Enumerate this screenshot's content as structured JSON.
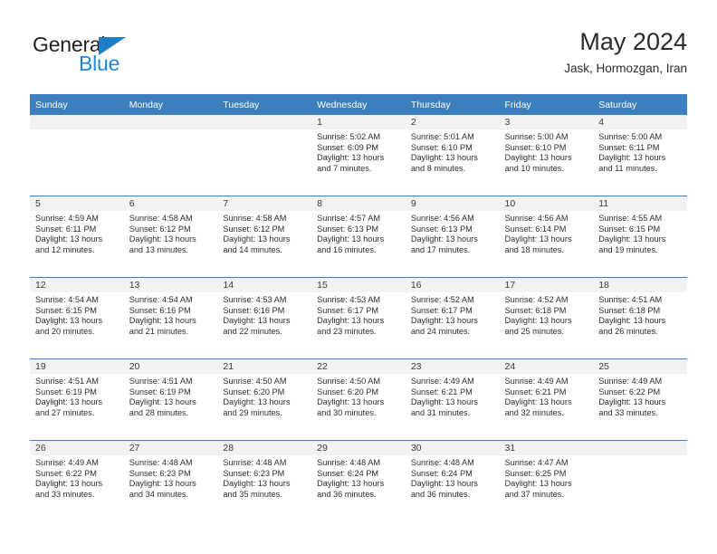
{
  "brand": {
    "name_top": "General",
    "name_bottom": "Blue",
    "color_dark": "#231f20",
    "color_blue": "#1f87d4"
  },
  "header": {
    "title": "May 2024",
    "subtitle": "Jask, Hormozgan, Iran"
  },
  "theme": {
    "header_band": "#3d7ebd",
    "day_band": "#f2f2f2",
    "text": "#2d2d2d"
  },
  "weekdays": [
    "Sunday",
    "Monday",
    "Tuesday",
    "Wednesday",
    "Thursday",
    "Friday",
    "Saturday"
  ],
  "labels": {
    "sunrise": "Sunrise:",
    "sunset": "Sunset:",
    "daylight": "Daylight:"
  },
  "weeks": [
    [
      {
        "day": "",
        "sunrise": "",
        "sunset": "",
        "daylight": ""
      },
      {
        "day": "",
        "sunrise": "",
        "sunset": "",
        "daylight": ""
      },
      {
        "day": "",
        "sunrise": "",
        "sunset": "",
        "daylight": ""
      },
      {
        "day": "1",
        "sunrise": "Sunrise: 5:02 AM",
        "sunset": "Sunset: 6:09 PM",
        "daylight": "Daylight: 13 hours and 7 minutes."
      },
      {
        "day": "2",
        "sunrise": "Sunrise: 5:01 AM",
        "sunset": "Sunset: 6:10 PM",
        "daylight": "Daylight: 13 hours and 8 minutes."
      },
      {
        "day": "3",
        "sunrise": "Sunrise: 5:00 AM",
        "sunset": "Sunset: 6:10 PM",
        "daylight": "Daylight: 13 hours and 10 minutes."
      },
      {
        "day": "4",
        "sunrise": "Sunrise: 5:00 AM",
        "sunset": "Sunset: 6:11 PM",
        "daylight": "Daylight: 13 hours and 11 minutes."
      }
    ],
    [
      {
        "day": "5",
        "sunrise": "Sunrise: 4:59 AM",
        "sunset": "Sunset: 6:11 PM",
        "daylight": "Daylight: 13 hours and 12 minutes."
      },
      {
        "day": "6",
        "sunrise": "Sunrise: 4:58 AM",
        "sunset": "Sunset: 6:12 PM",
        "daylight": "Daylight: 13 hours and 13 minutes."
      },
      {
        "day": "7",
        "sunrise": "Sunrise: 4:58 AM",
        "sunset": "Sunset: 6:12 PM",
        "daylight": "Daylight: 13 hours and 14 minutes."
      },
      {
        "day": "8",
        "sunrise": "Sunrise: 4:57 AM",
        "sunset": "Sunset: 6:13 PM",
        "daylight": "Daylight: 13 hours and 16 minutes."
      },
      {
        "day": "9",
        "sunrise": "Sunrise: 4:56 AM",
        "sunset": "Sunset: 6:13 PM",
        "daylight": "Daylight: 13 hours and 17 minutes."
      },
      {
        "day": "10",
        "sunrise": "Sunrise: 4:56 AM",
        "sunset": "Sunset: 6:14 PM",
        "daylight": "Daylight: 13 hours and 18 minutes."
      },
      {
        "day": "11",
        "sunrise": "Sunrise: 4:55 AM",
        "sunset": "Sunset: 6:15 PM",
        "daylight": "Daylight: 13 hours and 19 minutes."
      }
    ],
    [
      {
        "day": "12",
        "sunrise": "Sunrise: 4:54 AM",
        "sunset": "Sunset: 6:15 PM",
        "daylight": "Daylight: 13 hours and 20 minutes."
      },
      {
        "day": "13",
        "sunrise": "Sunrise: 4:54 AM",
        "sunset": "Sunset: 6:16 PM",
        "daylight": "Daylight: 13 hours and 21 minutes."
      },
      {
        "day": "14",
        "sunrise": "Sunrise: 4:53 AM",
        "sunset": "Sunset: 6:16 PM",
        "daylight": "Daylight: 13 hours and 22 minutes."
      },
      {
        "day": "15",
        "sunrise": "Sunrise: 4:53 AM",
        "sunset": "Sunset: 6:17 PM",
        "daylight": "Daylight: 13 hours and 23 minutes."
      },
      {
        "day": "16",
        "sunrise": "Sunrise: 4:52 AM",
        "sunset": "Sunset: 6:17 PM",
        "daylight": "Daylight: 13 hours and 24 minutes."
      },
      {
        "day": "17",
        "sunrise": "Sunrise: 4:52 AM",
        "sunset": "Sunset: 6:18 PM",
        "daylight": "Daylight: 13 hours and 25 minutes."
      },
      {
        "day": "18",
        "sunrise": "Sunrise: 4:51 AM",
        "sunset": "Sunset: 6:18 PM",
        "daylight": "Daylight: 13 hours and 26 minutes."
      }
    ],
    [
      {
        "day": "19",
        "sunrise": "Sunrise: 4:51 AM",
        "sunset": "Sunset: 6:19 PM",
        "daylight": "Daylight: 13 hours and 27 minutes."
      },
      {
        "day": "20",
        "sunrise": "Sunrise: 4:51 AM",
        "sunset": "Sunset: 6:19 PM",
        "daylight": "Daylight: 13 hours and 28 minutes."
      },
      {
        "day": "21",
        "sunrise": "Sunrise: 4:50 AM",
        "sunset": "Sunset: 6:20 PM",
        "daylight": "Daylight: 13 hours and 29 minutes."
      },
      {
        "day": "22",
        "sunrise": "Sunrise: 4:50 AM",
        "sunset": "Sunset: 6:20 PM",
        "daylight": "Daylight: 13 hours and 30 minutes."
      },
      {
        "day": "23",
        "sunrise": "Sunrise: 4:49 AM",
        "sunset": "Sunset: 6:21 PM",
        "daylight": "Daylight: 13 hours and 31 minutes."
      },
      {
        "day": "24",
        "sunrise": "Sunrise: 4:49 AM",
        "sunset": "Sunset: 6:21 PM",
        "daylight": "Daylight: 13 hours and 32 minutes."
      },
      {
        "day": "25",
        "sunrise": "Sunrise: 4:49 AM",
        "sunset": "Sunset: 6:22 PM",
        "daylight": "Daylight: 13 hours and 33 minutes."
      }
    ],
    [
      {
        "day": "26",
        "sunrise": "Sunrise: 4:49 AM",
        "sunset": "Sunset: 6:22 PM",
        "daylight": "Daylight: 13 hours and 33 minutes."
      },
      {
        "day": "27",
        "sunrise": "Sunrise: 4:48 AM",
        "sunset": "Sunset: 6:23 PM",
        "daylight": "Daylight: 13 hours and 34 minutes."
      },
      {
        "day": "28",
        "sunrise": "Sunrise: 4:48 AM",
        "sunset": "Sunset: 6:23 PM",
        "daylight": "Daylight: 13 hours and 35 minutes."
      },
      {
        "day": "29",
        "sunrise": "Sunrise: 4:48 AM",
        "sunset": "Sunset: 6:24 PM",
        "daylight": "Daylight: 13 hours and 36 minutes."
      },
      {
        "day": "30",
        "sunrise": "Sunrise: 4:48 AM",
        "sunset": "Sunset: 6:24 PM",
        "daylight": "Daylight: 13 hours and 36 minutes."
      },
      {
        "day": "31",
        "sunrise": "Sunrise: 4:47 AM",
        "sunset": "Sunset: 6:25 PM",
        "daylight": "Daylight: 13 hours and 37 minutes."
      },
      {
        "day": "",
        "sunrise": "",
        "sunset": "",
        "daylight": ""
      }
    ]
  ]
}
